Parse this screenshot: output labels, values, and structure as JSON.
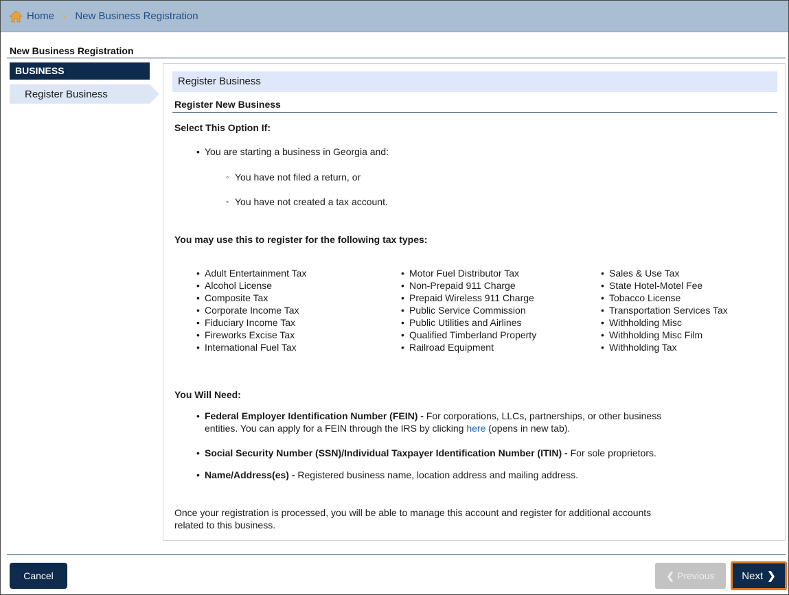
{
  "breadcrumb": {
    "home_label": "Home",
    "current_label": "New Business Registration"
  },
  "page_title": "New Business Registration",
  "sidebar": {
    "header": "BUSINESS",
    "items": [
      {
        "label": "Register Business"
      }
    ]
  },
  "main": {
    "card_header": "Register Business",
    "section_title": "Register New Business",
    "select_option": {
      "heading": "Select This Option If:",
      "bullet": "You are starting a business in Georgia and:",
      "sub_bullets": [
        "You have not filed a return, or",
        "You have not created a tax account."
      ]
    },
    "tax_types": {
      "heading": "You may use this to register for the following tax types:",
      "columns": [
        [
          "Adult Entertainment Tax",
          "Alcohol License",
          "Composite Tax",
          "Corporate Income Tax",
          "Fiduciary Income Tax",
          "Fireworks Excise Tax",
          "International Fuel Tax"
        ],
        [
          "Motor Fuel Distributor Tax",
          "Non-Prepaid 911 Charge",
          "Prepaid Wireless 911 Charge",
          "Public Service Commission",
          "Public Utilities and Airlines",
          "Qualified Timberland Property",
          "Railroad Equipment"
        ],
        [
          "Sales & Use Tax",
          "State Hotel-Motel Fee",
          "Tobacco License",
          "Transportation Services Tax",
          "Withholding Misc",
          "Withholding Misc Film",
          "Withholding Tax"
        ]
      ]
    },
    "you_will_need": {
      "heading": "You Will Need:",
      "fein_term": "Federal Employer Identification Number (FEIN) -",
      "fein_text_1": "For corporations, LLCs, partnerships, or other business",
      "fein_text_2a": "entities. You can apply for a FEIN through the IRS by clicking",
      "fein_link": "here",
      "fein_text_2b": "(opens in new tab).",
      "ssn_term": "Social Security Number (SSN)/Individual Taxpayer Identification Number (ITIN) -",
      "ssn_text": "For sole proprietors.",
      "name_term": "Name/Address(es) -",
      "name_text": "Registered business name, location address and mailing address."
    },
    "closing_line_1": "Once your registration is processed, you will be able to manage this account and register for additional accounts",
    "closing_line_2": "related to this business."
  },
  "footer": {
    "cancel_label": "Cancel",
    "previous_label": "Previous",
    "next_label": "Next"
  },
  "colors": {
    "navy": "#0e2a4d",
    "breadcrumb_bg": "#a9bed3",
    "card_header_bg": "#dfe7fa",
    "focus_outline": "#e07a1f",
    "link": "#1a62c2"
  },
  "icons": {
    "home": "home-icon",
    "breadcrumb_separator": "chevron-right-icon",
    "previous": "chevron-left-icon",
    "next": "chevron-right-icon"
  }
}
